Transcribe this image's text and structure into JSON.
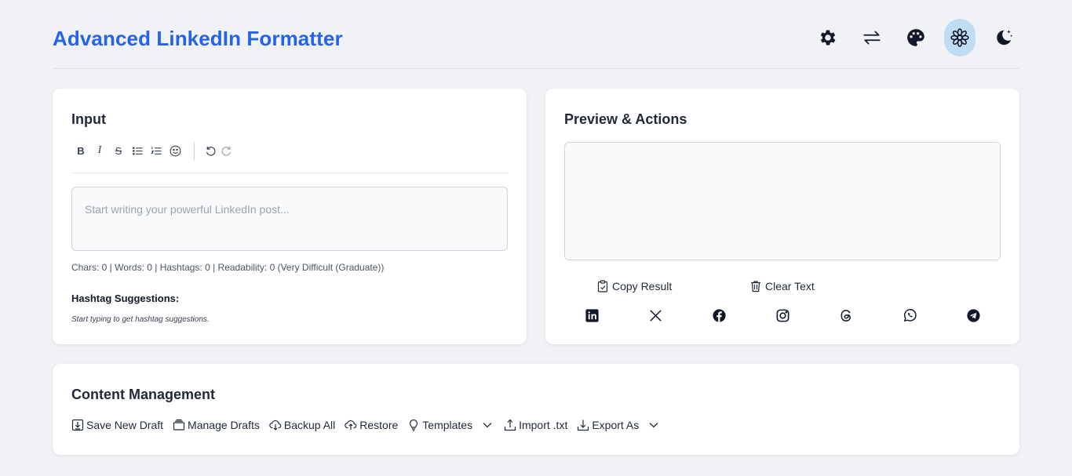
{
  "app": {
    "title": "Advanced LinkedIn Formatter"
  },
  "header_icons": [
    "gear-icon",
    "swap-arrows-icon",
    "palette-icon",
    "flower-icon",
    "moon-stars-icon"
  ],
  "input_card": {
    "title": "Input",
    "toolbar": {
      "bold": "B",
      "italic": "I",
      "strike": "S"
    },
    "placeholder": "Start writing your powerful LinkedIn post...",
    "stats": "Chars: 0 | Words: 0 | Hashtags: 0 | Readability: 0 (Very Difficult (Graduate))",
    "hashtag_title": "Hashtag Suggestions:",
    "hashtag_hint": "Start typing to get hashtag suggestions."
  },
  "preview_card": {
    "title": "Preview & Actions",
    "copy_label": "Copy Result",
    "clear_label": "Clear Text",
    "share_icons": [
      "linkedin-icon",
      "x-icon",
      "facebook-icon",
      "instagram-icon",
      "threads-icon",
      "whatsapp-icon",
      "telegram-icon"
    ]
  },
  "content_card": {
    "title": "Content Management",
    "save_label": "Save New Draft",
    "manage_label": "Manage Drafts",
    "backup_label": "Backup All",
    "restore_label": "Restore",
    "templates_label": "Templates",
    "import_label": "Import .txt",
    "export_label": "Export As"
  },
  "colors": {
    "accent": "#2563eb",
    "active_icon_bg": "#bfdcf5",
    "background": "#f1f2f5"
  }
}
